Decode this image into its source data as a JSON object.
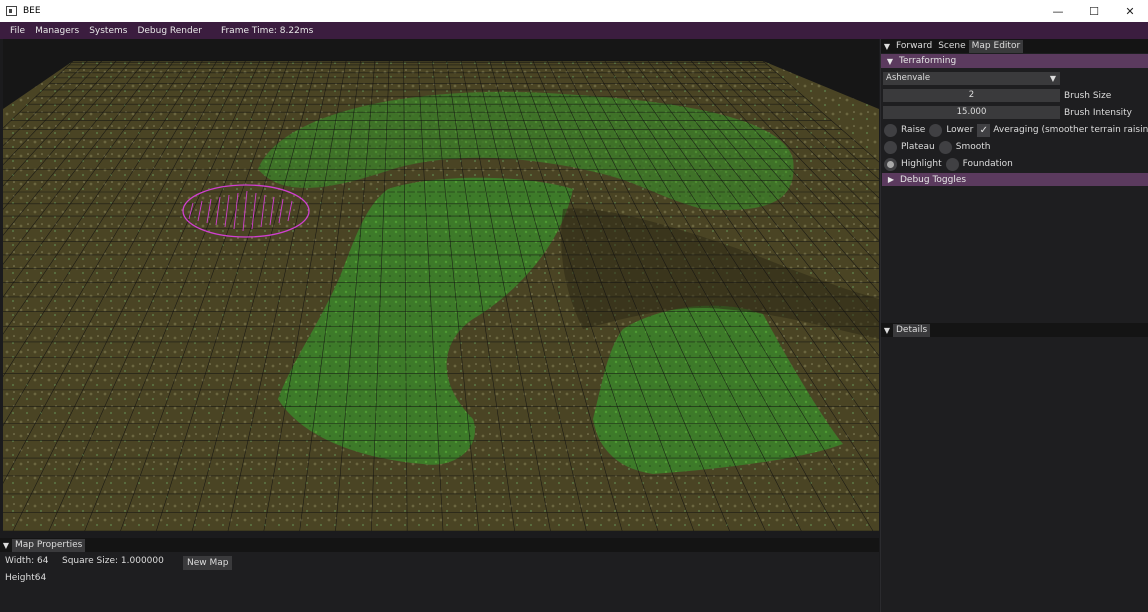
{
  "window": {
    "title": "BEE",
    "minimize_glyph": "—",
    "maximize_glyph": "☐",
    "close_glyph": "✕"
  },
  "menubar": {
    "items": [
      "File",
      "Managers",
      "Systems",
      "Debug Render"
    ],
    "frame_time": "Frame Time: 8.22ms"
  },
  "right_panel": {
    "tabs": [
      "Forward",
      "Scene",
      "Map Editor"
    ],
    "active_tab": "Map Editor",
    "terraforming": {
      "header": "Terraforming",
      "tileset_selected": "Ashenvale",
      "brush_size_value": "2",
      "brush_size_label": "Brush Size",
      "brush_intensity_value": "15.000",
      "brush_intensity_label": "Brush Intensity",
      "modes": {
        "raise": "Raise",
        "lower": "Lower",
        "averaging": "Averaging (smoother terrain raising and",
        "plateau": "Plateau",
        "smooth": "Smooth",
        "highlight": "Highlight",
        "foundation": "Foundation"
      },
      "averaging_checked": true,
      "selected_mode": "Highlight"
    },
    "debug_toggles_header": "Debug Toggles",
    "details_tab": "Details"
  },
  "bottom_panel": {
    "tab": "Map Properties",
    "width_text": "Width: 64",
    "square_size_text": "Square Size: 1.000000",
    "height_text": "Height64",
    "new_map_label": "New Map"
  },
  "colors": {
    "menu_bar": "#3b1d3f",
    "section_header": "#5b3a5e",
    "panel_bg": "#1e1e20",
    "terrain_dirt": "#4a4222",
    "terrain_grass": "#3f7a2a",
    "brush_cursor": "#d040d0"
  }
}
